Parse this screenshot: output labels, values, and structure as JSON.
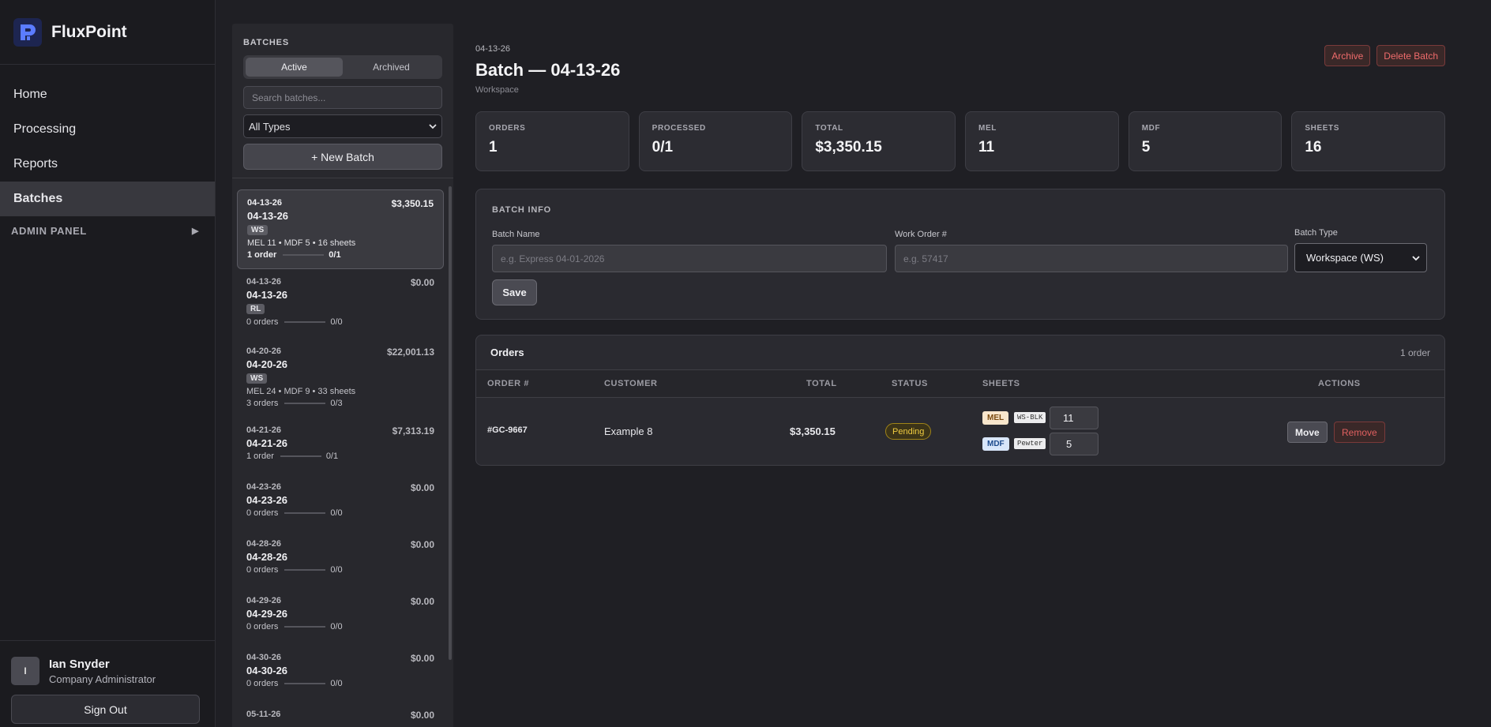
{
  "app": {
    "name": "FluxPoint",
    "accent": "#3b5bdb"
  },
  "nav": {
    "items": [
      {
        "label": "Home"
      },
      {
        "label": "Processing"
      },
      {
        "label": "Reports"
      },
      {
        "label": "Batches",
        "active": true
      }
    ],
    "admin_panel": "ADMIN PANEL"
  },
  "user": {
    "initial": "I",
    "name": "Ian Snyder",
    "role": "Company Administrator",
    "sign_out": "Sign Out"
  },
  "batches_panel": {
    "title": "BATCHES",
    "tabs": [
      {
        "label": "Active",
        "active": true
      },
      {
        "label": "Archived"
      }
    ],
    "search_placeholder": "Search batches...",
    "type_filter": "All Types",
    "new_batch": "+ New Batch",
    "items": [
      {
        "date": "04-13-26",
        "amount": "$3,350.15",
        "name": "04-13-26",
        "tag": "WS",
        "sheets": "MEL 11 • MDF 5 • 16 sheets",
        "orders": "1 order",
        "progress": "0/1",
        "active": true
      },
      {
        "date": "04-13-26",
        "amount": "$0.00",
        "name": "04-13-26",
        "tag": "RL",
        "sheets": "",
        "orders": "0 orders",
        "progress": "0/0"
      },
      {
        "date": "04-20-26",
        "amount": "$22,001.13",
        "name": "04-20-26",
        "tag": "WS",
        "sheets": "MEL 24 • MDF 9 • 33 sheets",
        "orders": "3 orders",
        "progress": "0/3"
      },
      {
        "date": "04-21-26",
        "amount": "$7,313.19",
        "name": "04-21-26",
        "tag": "",
        "sheets": "",
        "orders": "1 order",
        "progress": "0/1"
      },
      {
        "date": "04-23-26",
        "amount": "$0.00",
        "name": "04-23-26",
        "tag": "",
        "sheets": "",
        "orders": "0 orders",
        "progress": "0/0"
      },
      {
        "date": "04-28-26",
        "amount": "$0.00",
        "name": "04-28-26",
        "tag": "",
        "sheets": "",
        "orders": "0 orders",
        "progress": "0/0"
      },
      {
        "date": "04-29-26",
        "amount": "$0.00",
        "name": "04-29-26",
        "tag": "",
        "sheets": "",
        "orders": "0 orders",
        "progress": "0/0"
      },
      {
        "date": "04-30-26",
        "amount": "$0.00",
        "name": "04-30-26",
        "tag": "",
        "sheets": "",
        "orders": "0 orders",
        "progress": "0/0"
      },
      {
        "date": "05-11-26",
        "amount": "$0.00",
        "name": "",
        "tag": "",
        "sheets": "",
        "orders": "",
        "progress": ""
      }
    ]
  },
  "main": {
    "crumb": "04-13-26",
    "title": "Batch — 04-13-26",
    "subtitle": "Workspace",
    "archive": "Archive",
    "delete": "Delete Batch",
    "stats": [
      {
        "label": "ORDERS",
        "value": "1"
      },
      {
        "label": "PROCESSED",
        "value": "0/1"
      },
      {
        "label": "TOTAL",
        "value": "$3,350.15"
      },
      {
        "label": "MEL",
        "value": "11"
      },
      {
        "label": "MDF",
        "value": "5"
      },
      {
        "label": "SHEETS",
        "value": "16"
      }
    ],
    "batch_info": {
      "title": "BATCH INFO",
      "name_label": "Batch Name",
      "name_placeholder": "e.g. Express 04-01-2026",
      "wo_label": "Work Order #",
      "wo_placeholder": "e.g. 57417",
      "type_label": "Batch Type",
      "type_value": "Workspace (WS)",
      "save": "Save"
    },
    "orders": {
      "title": "Orders",
      "count": "1 order",
      "columns": [
        "ORDER #",
        "CUSTOMER",
        "TOTAL",
        "STATUS",
        "SHEETS",
        "ACTIONS"
      ],
      "rows": [
        {
          "order": "#GC-9667",
          "customer": "Example 8",
          "total": "$3,350.15",
          "status": "Pending",
          "sheets": [
            {
              "material": "MEL",
              "color": "WS-BLK",
              "qty": "11"
            },
            {
              "material": "MDF",
              "color": "Pewter",
              "qty": "5"
            }
          ],
          "move": "Move",
          "remove": "Remove"
        }
      ]
    }
  }
}
